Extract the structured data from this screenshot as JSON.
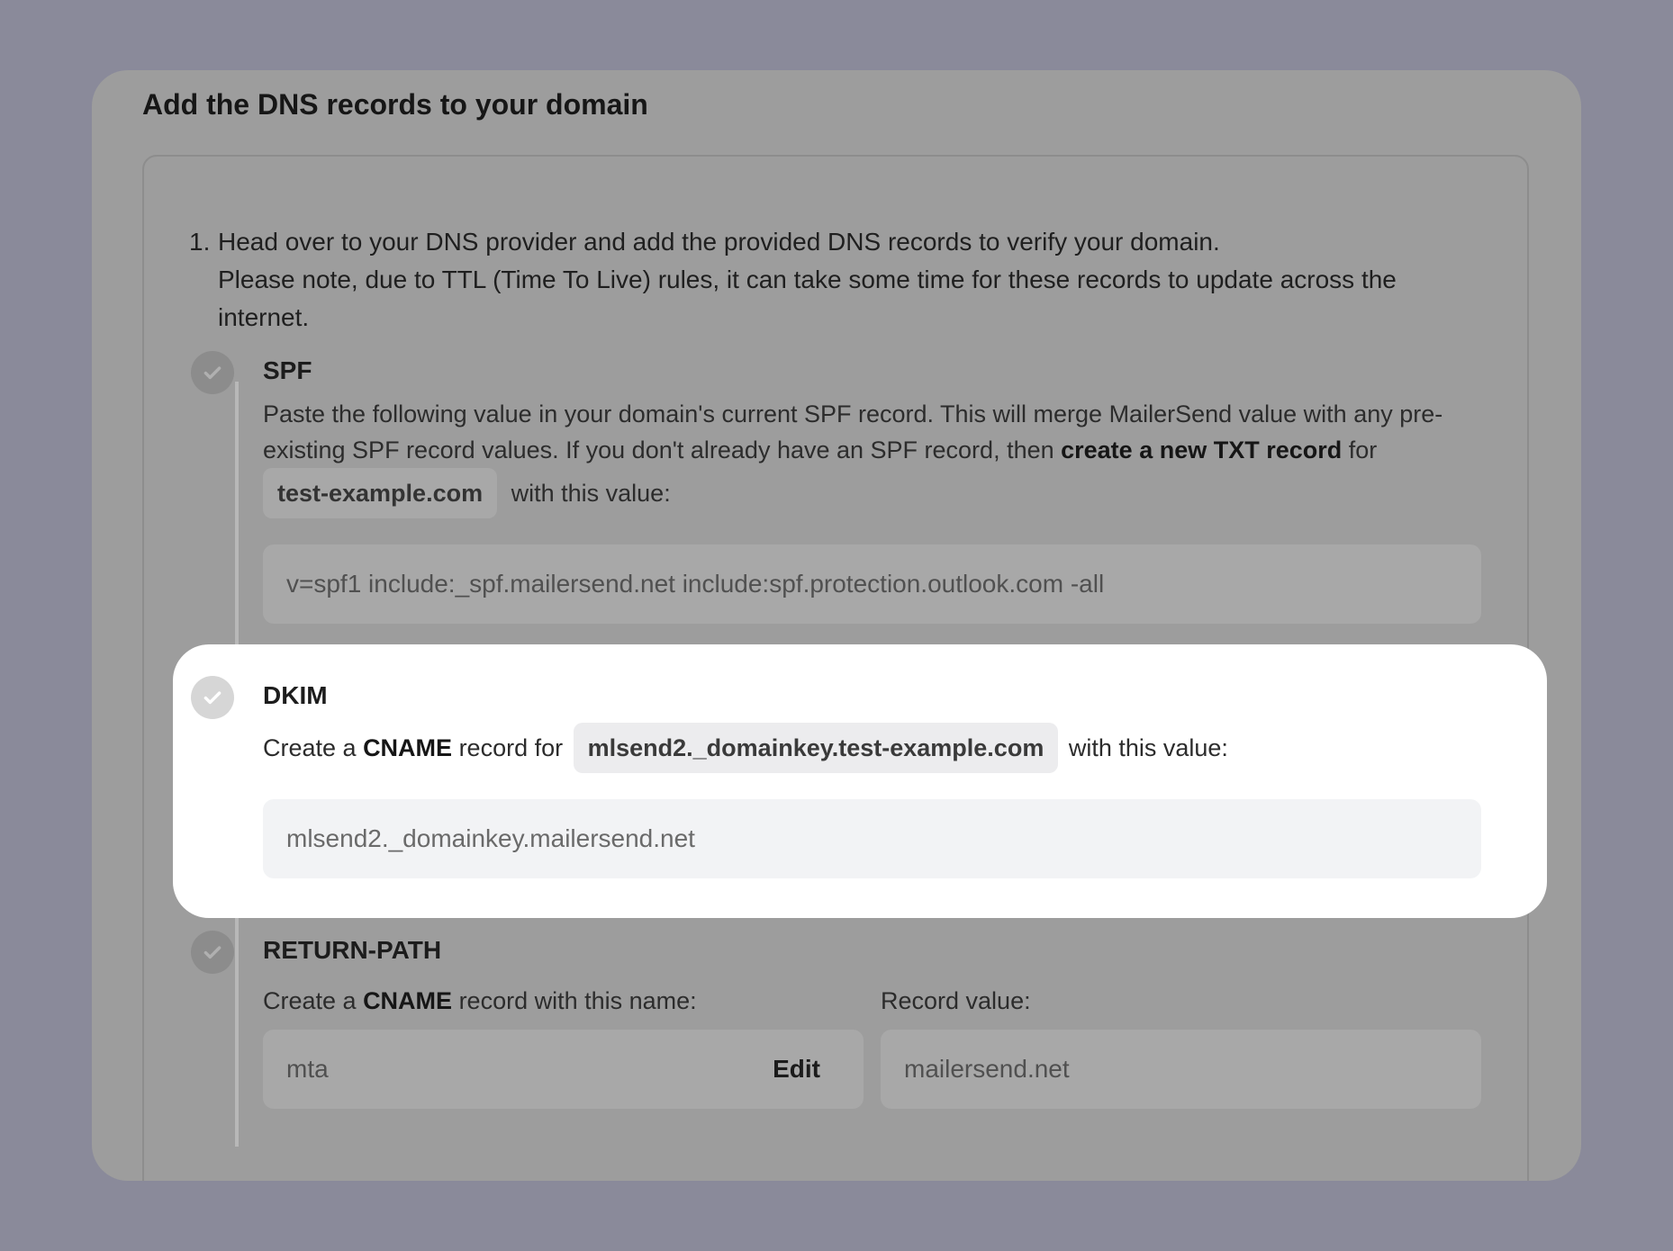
{
  "card": {
    "title": "Add the DNS records to your domain"
  },
  "instructions": {
    "number": "1.",
    "line1": "Head over to your DNS provider and add the provided DNS records to verify your domain.",
    "line2": "Please note, due to TTL (Time To Live) rules, it can take some time for these records to update across the",
    "line3": "internet."
  },
  "spf": {
    "title": "SPF",
    "text_a": "Paste the following value in your domain's current SPF record. This will merge MailerSend value with any pre-",
    "text_b": "existing SPF record values. If you don't already have an SPF record, then ",
    "text_b_bold": "create a new TXT record",
    "text_b_end": " for",
    "domain_chip": "test-example.com",
    "text_c": "with this value:",
    "value": "v=spf1 include:_spf.mailersend.net include:spf.protection.outlook.com -all"
  },
  "dkim": {
    "title": "DKIM",
    "text_a": "Create a ",
    "text_bold": "CNAME",
    "text_b": " record for",
    "host_chip": "mlsend2._domainkey.test-example.com",
    "text_c": "with this value:",
    "value": "mlsend2._domainkey.mailersend.net"
  },
  "return_path": {
    "title": "RETURN-PATH",
    "name_label_a": "Create a ",
    "name_label_bold": "CNAME",
    "name_label_b": " record with this name:",
    "value_label": "Record value:",
    "name_value": "mta",
    "edit_label": "Edit",
    "record_value": "mailersend.net"
  },
  "colors": {
    "overlay": "#8a8a9a",
    "card_dimmed": "#9d9d9d",
    "highlight": "#ffffff",
    "field_light": "#f2f3f5"
  }
}
